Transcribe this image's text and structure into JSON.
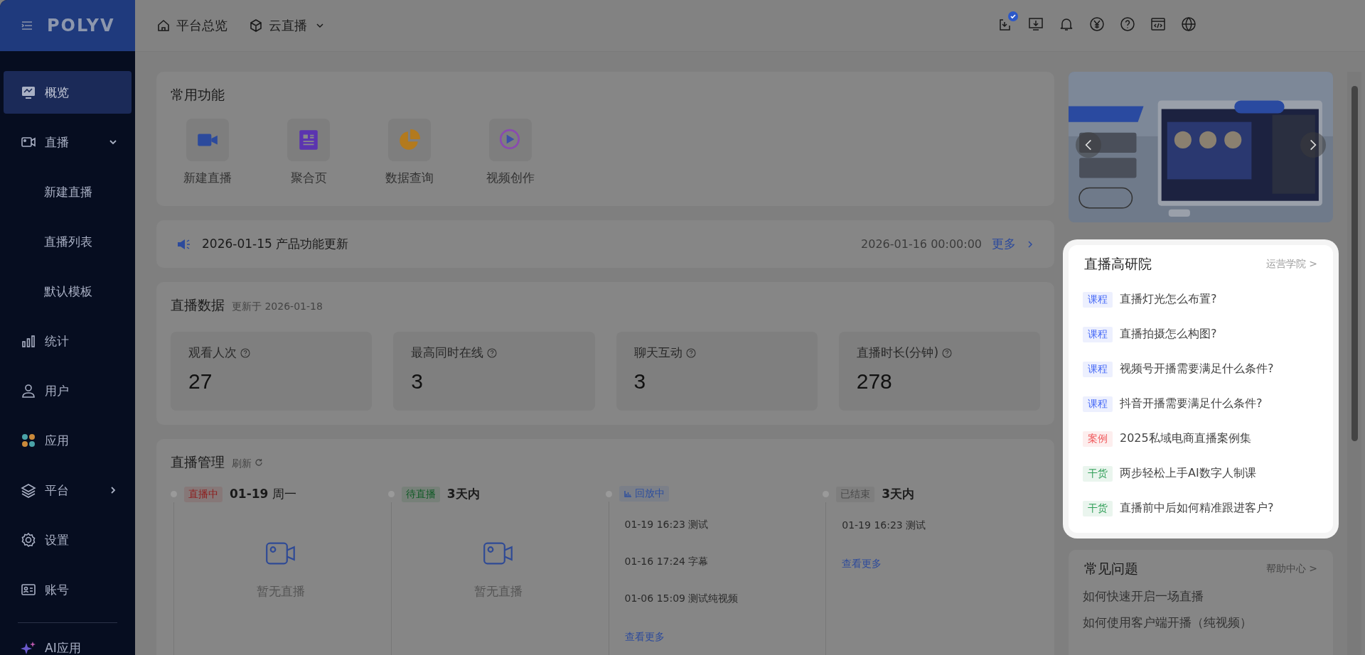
{
  "header": {
    "logo": "POLYV",
    "nav": [
      {
        "kind": "home",
        "label": "平台总览",
        "dropdown": false
      },
      {
        "kind": "cube",
        "label": "云直播",
        "dropdown": true
      }
    ],
    "tools": [
      {
        "kind": "task",
        "badge": true
      },
      {
        "kind": "download",
        "badge": false
      },
      {
        "kind": "bell",
        "badge": false
      },
      {
        "kind": "yen",
        "badge": false
      },
      {
        "kind": "help",
        "badge": false
      },
      {
        "kind": "code",
        "badge": false
      },
      {
        "kind": "globe",
        "badge": false
      }
    ]
  },
  "sidebar": {
    "items": [
      {
        "kind": "monitor",
        "label": "概览",
        "selected": true
      },
      {
        "kind": "camera",
        "label": "直播",
        "selected": false,
        "expanded": true,
        "children": [
          {
            "label": "新建直播",
            "selected": false
          },
          {
            "label": "直播列表",
            "selected": false
          },
          {
            "label": "默认模板",
            "selected": false
          }
        ]
      },
      {
        "kind": "chart",
        "label": "统计",
        "selected": false
      },
      {
        "kind": "user",
        "label": "用户",
        "selected": false
      },
      {
        "kind": "apps",
        "label": "应用",
        "selected": false
      },
      {
        "kind": "layers",
        "label": "平台",
        "selected": false,
        "expanded": false
      },
      {
        "kind": "gear",
        "label": "设置",
        "selected": false
      },
      {
        "kind": "card",
        "label": "账号",
        "selected": false
      }
    ],
    "footer": {
      "kind": "spark",
      "label": "AI应用"
    }
  },
  "quick_functions": {
    "title": "常用功能",
    "items": [
      {
        "kind": "video",
        "label": "新建直播"
      },
      {
        "kind": "page",
        "label": "聚合页"
      },
      {
        "kind": "pie",
        "label": "数据查询"
      },
      {
        "kind": "ai",
        "label": "视频创作"
      }
    ]
  },
  "announcement": {
    "text": "2026-01-15 产品功能更新",
    "time": "2026-01-16 00:00:00",
    "more": "更多"
  },
  "live_data": {
    "title": "直播数据",
    "updated": "更新于 2026-01-18",
    "stats": [
      {
        "label": "观看人次",
        "value": "27"
      },
      {
        "label": "最高同时在线",
        "value": "3"
      },
      {
        "label": "聊天互动",
        "value": "3"
      },
      {
        "label": "直播时长(分钟)",
        "value": "278"
      }
    ]
  },
  "management": {
    "title": "直播管理",
    "refresh": "刷新",
    "refresh_icon": true,
    "columns": [
      {
        "tag": "直播中",
        "color": "#8e1c1c",
        "tag_icon": false,
        "heading": "**01-19** 周一",
        "empty": "暂无直播"
      },
      {
        "tag": "待直播",
        "color": "#0f5a25",
        "tag_icon": false,
        "heading": "**3天内**",
        "empty": "暂无直播"
      },
      {
        "tag": "回放中",
        "color": "#2e4f9e",
        "tag_icon": true,
        "entries": [
          "01-19 16:23 测试",
          "01-16 17:24 字幕",
          "01-06 15:09 测试纯视频"
        ],
        "more": "查看更多"
      },
      {
        "tag": "已结束",
        "color": "#4a4a4a",
        "tag_icon": false,
        "heading": "**3天内**",
        "entries": [
          "01-19 16:23 测试"
        ],
        "more": "查看更多"
      }
    ]
  },
  "research": {
    "title": "直播高研院",
    "link": "运营学院 >",
    "items": [
      {
        "tag": "课程",
        "color": "#4a6cf7",
        "title": "直播灯光怎么布置?"
      },
      {
        "tag": "课程",
        "color": "#4a6cf7",
        "title": "直播拍摄怎么构图?"
      },
      {
        "tag": "课程",
        "color": "#4a6cf7",
        "title": "视频号开播需要满足什么条件?"
      },
      {
        "tag": "课程",
        "color": "#4a6cf7",
        "title": "抖音开播需要满足什么条件?"
      },
      {
        "tag": "案例",
        "color": "#f0575a",
        "title": "2025私域电商直播案例集"
      },
      {
        "tag": "干货",
        "color": "#2f9e57",
        "title": "两步轻松上手AI数字人制课"
      },
      {
        "tag": "干货",
        "color": "#2f9e57",
        "title": "直播前中后如何精准跟进客户?"
      }
    ]
  },
  "faq": {
    "title": "常见问题",
    "link": "帮助中心 >",
    "items": [
      "如何快速开启一场直播",
      "如何使用客户端开播（纯视频）"
    ]
  }
}
